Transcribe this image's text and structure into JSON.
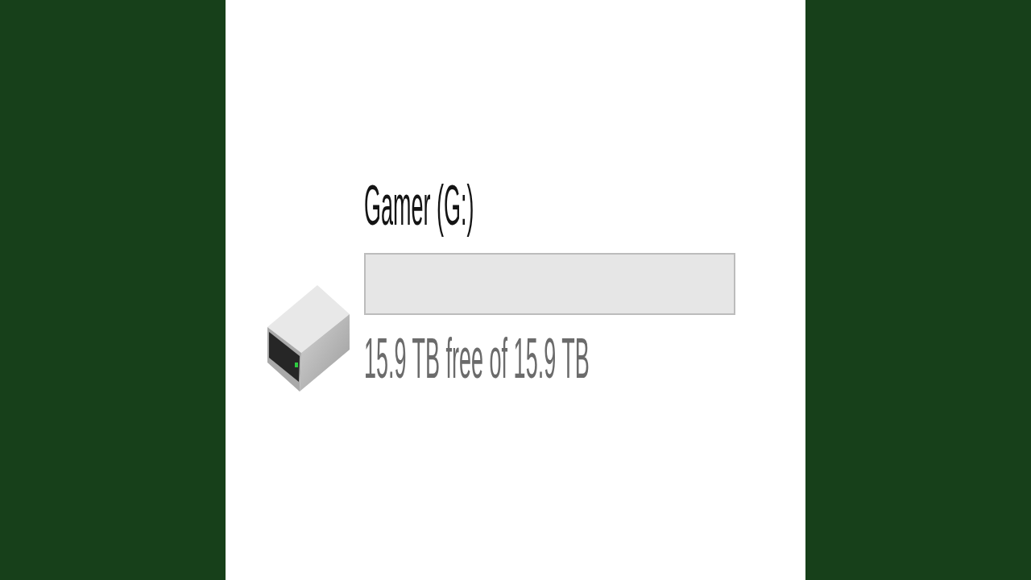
{
  "drive": {
    "name": "Gamer (G:)",
    "level": 0,
    "space": "15.9 TB free of 15.9 TB"
  }
}
